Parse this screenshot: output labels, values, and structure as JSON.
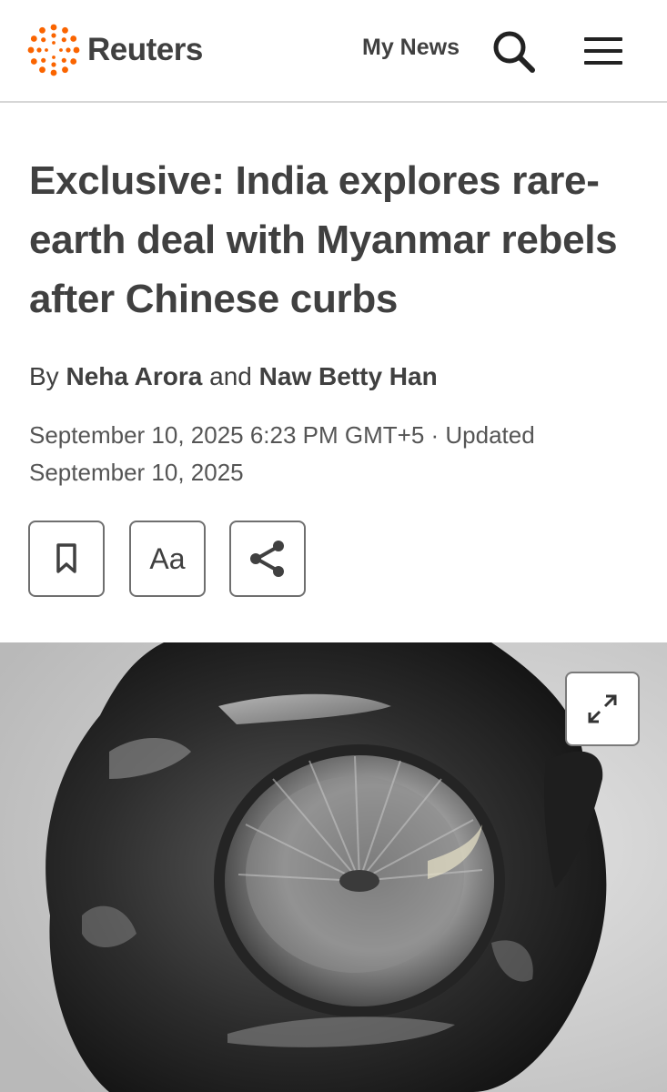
{
  "header": {
    "brand": "Reuters",
    "my_news": "My News",
    "brand_color": "#fa6400"
  },
  "article": {
    "headline": "Exclusive: India explores rare-earth deal with Myanmar rebels after Chinese curbs",
    "byline": {
      "prefix": "By",
      "author1": "Neha Arora",
      "joiner": "and",
      "author2": "Naw Betty Han"
    },
    "dateline": "September 10, 2025 6:23 PM GMT+5 · Updated September 10, 2025"
  },
  "tools": {
    "bookmark_icon": "bookmark-icon",
    "text_size_label": "Aa",
    "share_icon": "share-icon"
  },
  "media": {
    "image": "photo of a rare-earth metal sample",
    "expand_icon": "expand-icon"
  }
}
